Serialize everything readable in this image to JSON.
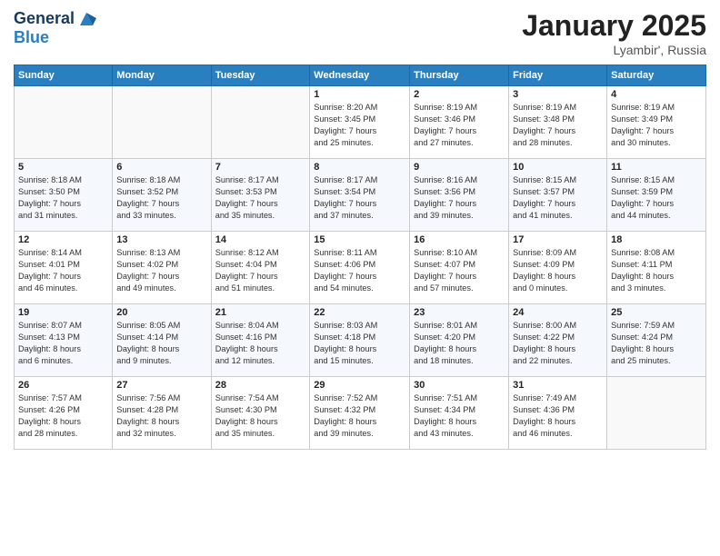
{
  "header": {
    "logo_line1": "General",
    "logo_line2": "Blue",
    "month": "January 2025",
    "location": "Lyambir', Russia"
  },
  "weekdays": [
    "Sunday",
    "Monday",
    "Tuesday",
    "Wednesday",
    "Thursday",
    "Friday",
    "Saturday"
  ],
  "weeks": [
    [
      {
        "day": "",
        "info": ""
      },
      {
        "day": "",
        "info": ""
      },
      {
        "day": "",
        "info": ""
      },
      {
        "day": "1",
        "info": "Sunrise: 8:20 AM\nSunset: 3:45 PM\nDaylight: 7 hours\nand 25 minutes."
      },
      {
        "day": "2",
        "info": "Sunrise: 8:19 AM\nSunset: 3:46 PM\nDaylight: 7 hours\nand 27 minutes."
      },
      {
        "day": "3",
        "info": "Sunrise: 8:19 AM\nSunset: 3:48 PM\nDaylight: 7 hours\nand 28 minutes."
      },
      {
        "day": "4",
        "info": "Sunrise: 8:19 AM\nSunset: 3:49 PM\nDaylight: 7 hours\nand 30 minutes."
      }
    ],
    [
      {
        "day": "5",
        "info": "Sunrise: 8:18 AM\nSunset: 3:50 PM\nDaylight: 7 hours\nand 31 minutes."
      },
      {
        "day": "6",
        "info": "Sunrise: 8:18 AM\nSunset: 3:52 PM\nDaylight: 7 hours\nand 33 minutes."
      },
      {
        "day": "7",
        "info": "Sunrise: 8:17 AM\nSunset: 3:53 PM\nDaylight: 7 hours\nand 35 minutes."
      },
      {
        "day": "8",
        "info": "Sunrise: 8:17 AM\nSunset: 3:54 PM\nDaylight: 7 hours\nand 37 minutes."
      },
      {
        "day": "9",
        "info": "Sunrise: 8:16 AM\nSunset: 3:56 PM\nDaylight: 7 hours\nand 39 minutes."
      },
      {
        "day": "10",
        "info": "Sunrise: 8:15 AM\nSunset: 3:57 PM\nDaylight: 7 hours\nand 41 minutes."
      },
      {
        "day": "11",
        "info": "Sunrise: 8:15 AM\nSunset: 3:59 PM\nDaylight: 7 hours\nand 44 minutes."
      }
    ],
    [
      {
        "day": "12",
        "info": "Sunrise: 8:14 AM\nSunset: 4:01 PM\nDaylight: 7 hours\nand 46 minutes."
      },
      {
        "day": "13",
        "info": "Sunrise: 8:13 AM\nSunset: 4:02 PM\nDaylight: 7 hours\nand 49 minutes."
      },
      {
        "day": "14",
        "info": "Sunrise: 8:12 AM\nSunset: 4:04 PM\nDaylight: 7 hours\nand 51 minutes."
      },
      {
        "day": "15",
        "info": "Sunrise: 8:11 AM\nSunset: 4:06 PM\nDaylight: 7 hours\nand 54 minutes."
      },
      {
        "day": "16",
        "info": "Sunrise: 8:10 AM\nSunset: 4:07 PM\nDaylight: 7 hours\nand 57 minutes."
      },
      {
        "day": "17",
        "info": "Sunrise: 8:09 AM\nSunset: 4:09 PM\nDaylight: 8 hours\nand 0 minutes."
      },
      {
        "day": "18",
        "info": "Sunrise: 8:08 AM\nSunset: 4:11 PM\nDaylight: 8 hours\nand 3 minutes."
      }
    ],
    [
      {
        "day": "19",
        "info": "Sunrise: 8:07 AM\nSunset: 4:13 PM\nDaylight: 8 hours\nand 6 minutes."
      },
      {
        "day": "20",
        "info": "Sunrise: 8:05 AM\nSunset: 4:14 PM\nDaylight: 8 hours\nand 9 minutes."
      },
      {
        "day": "21",
        "info": "Sunrise: 8:04 AM\nSunset: 4:16 PM\nDaylight: 8 hours\nand 12 minutes."
      },
      {
        "day": "22",
        "info": "Sunrise: 8:03 AM\nSunset: 4:18 PM\nDaylight: 8 hours\nand 15 minutes."
      },
      {
        "day": "23",
        "info": "Sunrise: 8:01 AM\nSunset: 4:20 PM\nDaylight: 8 hours\nand 18 minutes."
      },
      {
        "day": "24",
        "info": "Sunrise: 8:00 AM\nSunset: 4:22 PM\nDaylight: 8 hours\nand 22 minutes."
      },
      {
        "day": "25",
        "info": "Sunrise: 7:59 AM\nSunset: 4:24 PM\nDaylight: 8 hours\nand 25 minutes."
      }
    ],
    [
      {
        "day": "26",
        "info": "Sunrise: 7:57 AM\nSunset: 4:26 PM\nDaylight: 8 hours\nand 28 minutes."
      },
      {
        "day": "27",
        "info": "Sunrise: 7:56 AM\nSunset: 4:28 PM\nDaylight: 8 hours\nand 32 minutes."
      },
      {
        "day": "28",
        "info": "Sunrise: 7:54 AM\nSunset: 4:30 PM\nDaylight: 8 hours\nand 35 minutes."
      },
      {
        "day": "29",
        "info": "Sunrise: 7:52 AM\nSunset: 4:32 PM\nDaylight: 8 hours\nand 39 minutes."
      },
      {
        "day": "30",
        "info": "Sunrise: 7:51 AM\nSunset: 4:34 PM\nDaylight: 8 hours\nand 43 minutes."
      },
      {
        "day": "31",
        "info": "Sunrise: 7:49 AM\nSunset: 4:36 PM\nDaylight: 8 hours\nand 46 minutes."
      },
      {
        "day": "",
        "info": ""
      }
    ]
  ]
}
